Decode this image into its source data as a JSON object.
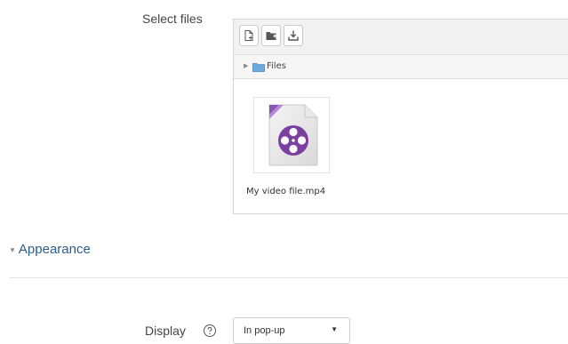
{
  "form": {
    "select_files_label": "Select files",
    "filepicker": {
      "toolbar": [
        {
          "icon": "add-file-icon"
        },
        {
          "icon": "create-folder-icon"
        },
        {
          "icon": "download-icon"
        }
      ],
      "path_label": "Files",
      "file": {
        "name": "My video file.mp4",
        "icon": "video-file-icon",
        "accent": "#7b3fa0"
      }
    },
    "section": {
      "title": "Appearance"
    },
    "display": {
      "label": "Display",
      "value": "In pop-up"
    }
  },
  "colors": {
    "section_title": "#2b5c8a",
    "toolbar_bg": "#f2f2f2",
    "video_icon": "#7b3fa0"
  }
}
